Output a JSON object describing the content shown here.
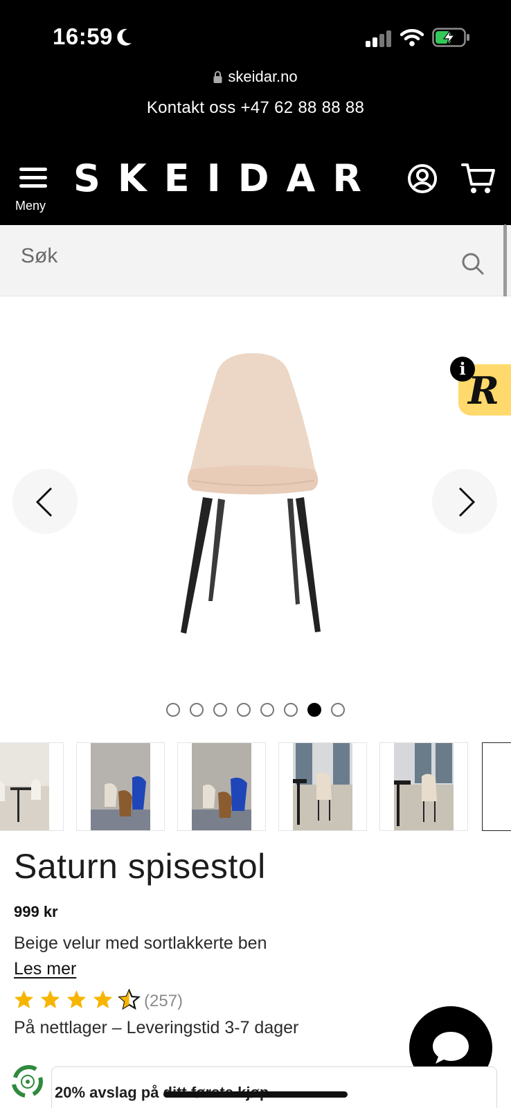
{
  "status_bar": {
    "time": "16:59"
  },
  "browser": {
    "url": "skeidar.no"
  },
  "header": {
    "contact": "Kontakt oss +47 62 88 88 88",
    "menu_label": "Meny",
    "logo": "SKEIDAR"
  },
  "search": {
    "placeholder": "Søk"
  },
  "gallery": {
    "slide_count": 8,
    "active_slide_index": 6,
    "badge_letter": "R",
    "badge_info": "i"
  },
  "product": {
    "title": "Saturn spisestol",
    "price": "999 kr",
    "description": "Beige velur med sortlakkerte ben",
    "read_more": "Les mer",
    "rating": 4.5,
    "rating_max": 5,
    "reviews": "(257)",
    "stock": "På nettlager – Leveringstid 3-7 dager"
  },
  "promo": {
    "text": "20% avslag på ditt første kjøp"
  },
  "colors": {
    "header_bg": "#000000",
    "star": "#f7b500",
    "badge": "#ffd96b",
    "battery_charge": "#34c759"
  },
  "icons": [
    "moon-icon",
    "signal-icon",
    "wifi-icon",
    "battery-icon",
    "lock-icon",
    "menu-icon",
    "account-icon",
    "cart-icon",
    "search-icon",
    "chevron-left-icon",
    "chevron-right-icon",
    "star-icon",
    "chat-icon",
    "eco-icon"
  ]
}
